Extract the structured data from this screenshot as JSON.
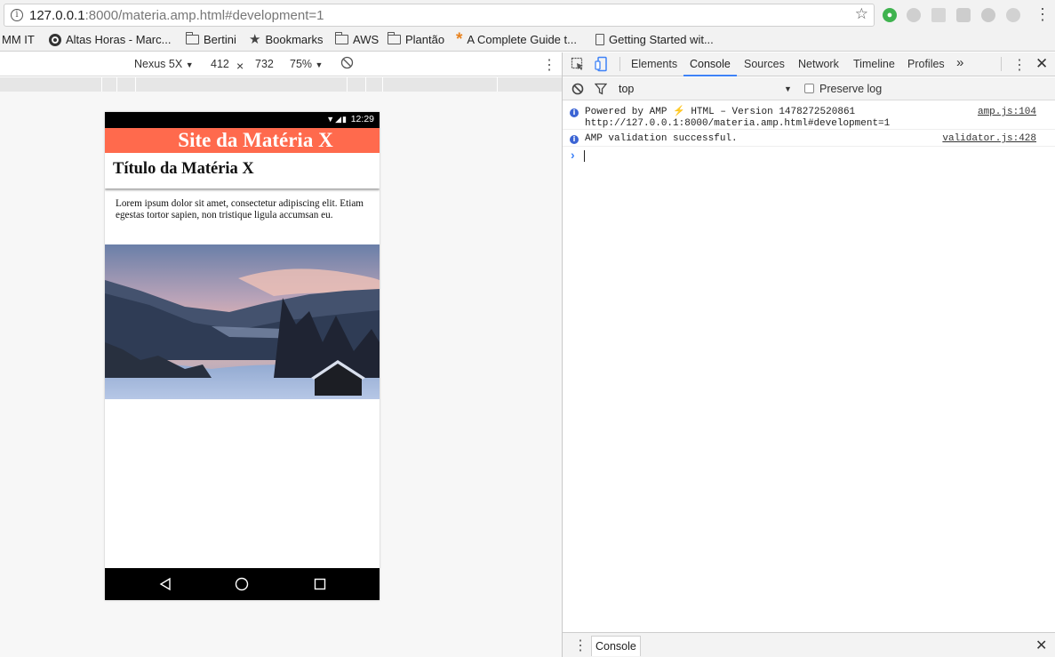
{
  "browser": {
    "url_host": "127.0.0.1",
    "url_rest": ":8000/materia.amp.html#development=1"
  },
  "bookmarks": [
    {
      "label": "MM IT",
      "icon": "none"
    },
    {
      "label": "Altas Horas - Marc...",
      "icon": "globe-icon"
    },
    {
      "label": "Bertini",
      "icon": "folder-icon"
    },
    {
      "label": "Bookmarks",
      "icon": "star-icon"
    },
    {
      "label": "AWS",
      "icon": "folder-icon"
    },
    {
      "label": "Plantão",
      "icon": "folder-icon"
    },
    {
      "label": "A Complete Guide t...",
      "icon": "asterisk-icon"
    },
    {
      "label": "Getting Started wit...",
      "icon": "page-icon"
    }
  ],
  "device_toolbar": {
    "device": "Nexus 5X",
    "width": "412",
    "times": "×",
    "height": "732",
    "zoom": "75%"
  },
  "phone": {
    "time": "12:29",
    "site_title": "Site da Matéria X",
    "article_title": "Título da Matéria X",
    "article_body": "Lorem ipsum dolor sit amet, consectetur adipiscing elit. Etiam egestas tortor sapien, non tristique ligula accumsan eu."
  },
  "devtools": {
    "tabs": [
      "Elements",
      "Console",
      "Sources",
      "Network",
      "Timeline",
      "Profiles"
    ],
    "active_tab": "Console",
    "more": "»",
    "context": "top",
    "preserve_log": "Preserve log",
    "messages": [
      {
        "text": "Powered by AMP ⚡ HTML – Version 1478272520861\nhttp://127.0.0.1:8000/materia.amp.html#development=1",
        "source": "amp.js:104"
      },
      {
        "text": "AMP validation successful.",
        "source": "validator.js:428"
      }
    ],
    "prompt": "›",
    "drawer_tab": "Console"
  },
  "colors": {
    "site_header": "#ff6a4d",
    "devtools_accent": "#3e82f7"
  }
}
